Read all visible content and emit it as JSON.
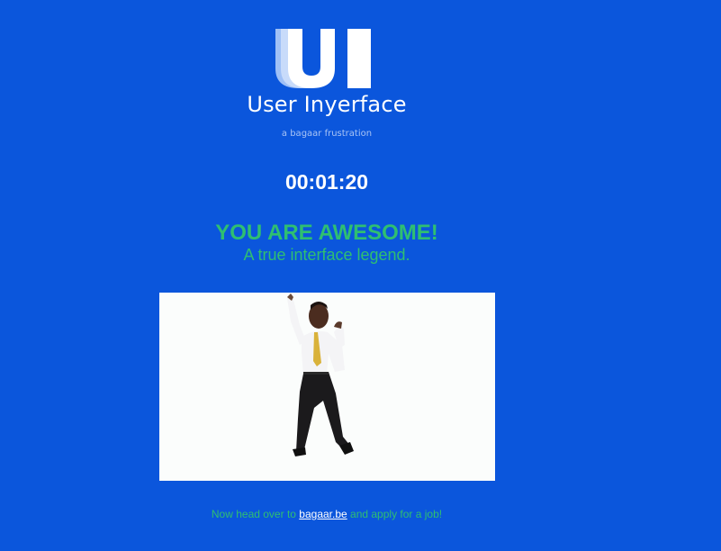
{
  "header": {
    "logo_icon": "ui-logo-icon",
    "title": "User Inyerface",
    "tagline": "a bagaar frustration"
  },
  "timer": {
    "value": "00:01:20"
  },
  "result": {
    "headline": "YOU ARE AWESOME!",
    "subheadline": "A true interface legend."
  },
  "media": {
    "description_icon": "dancing-person-image"
  },
  "footer": {
    "text_before": "Now head over to",
    "link_text": "bagaar.be",
    "text_after": "and apply for a job!"
  },
  "colors": {
    "background": "#0b56dc",
    "accent_green": "#2fbf71",
    "text_white": "#ffffff"
  }
}
